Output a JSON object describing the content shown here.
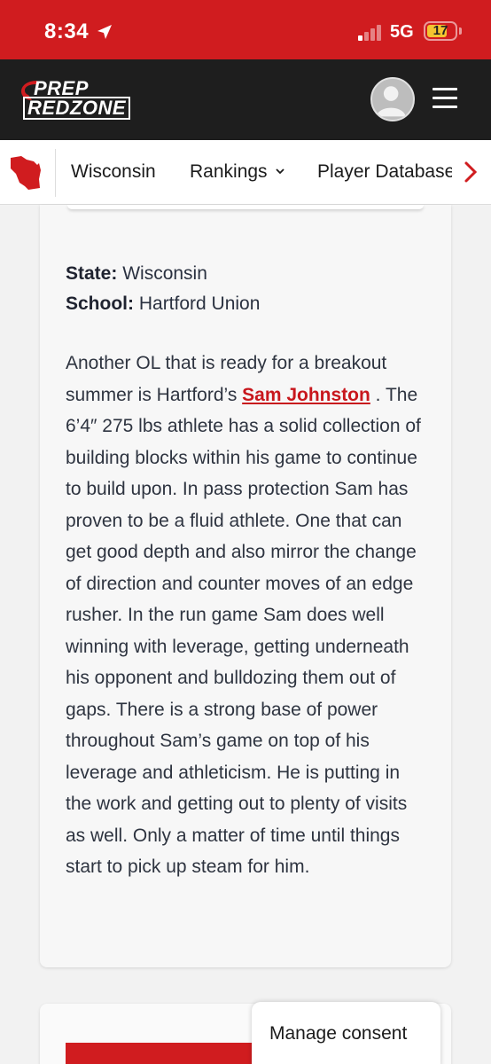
{
  "status_bar": {
    "time": "8:34",
    "network": "5G",
    "battery": "17"
  },
  "header": {
    "logo_line1": "PREP",
    "logo_line2": "REDZONE"
  },
  "nav": {
    "items": [
      {
        "label": "Wisconsin"
      },
      {
        "label": "Rankings"
      },
      {
        "label": "Player Database"
      }
    ]
  },
  "article": {
    "state_label": "State:",
    "state_value": "Wisconsin",
    "school_label": "School:",
    "school_value": "Hartford Union",
    "body_before_link": "Another OL that is ready for a breakout summer is Hartford’s ",
    "player_link": "Sam Johnston",
    "body_after_link": " . The 6’4″ 275 lbs athlete has a solid collection of building blocks within his game to continue to build upon. In pass protection Sam has proven to be a fluid athlete. One that can get good depth and also mirror the change of direction and counter moves of an edge rusher. In the run game Sam does well winning with leverage, getting underneath his opponent and bulldozing them out of gaps. There is a strong base of power throughout Sam’s game on top of his leverage and athleticism. He is putting in the work and getting out to plenty of visits as well. Only a matter of time until things start to pick up steam for him."
  },
  "consent": {
    "label": "Manage consent"
  },
  "colors": {
    "brand_red": "#d01c1f",
    "header_dark": "#1e1e1e"
  }
}
